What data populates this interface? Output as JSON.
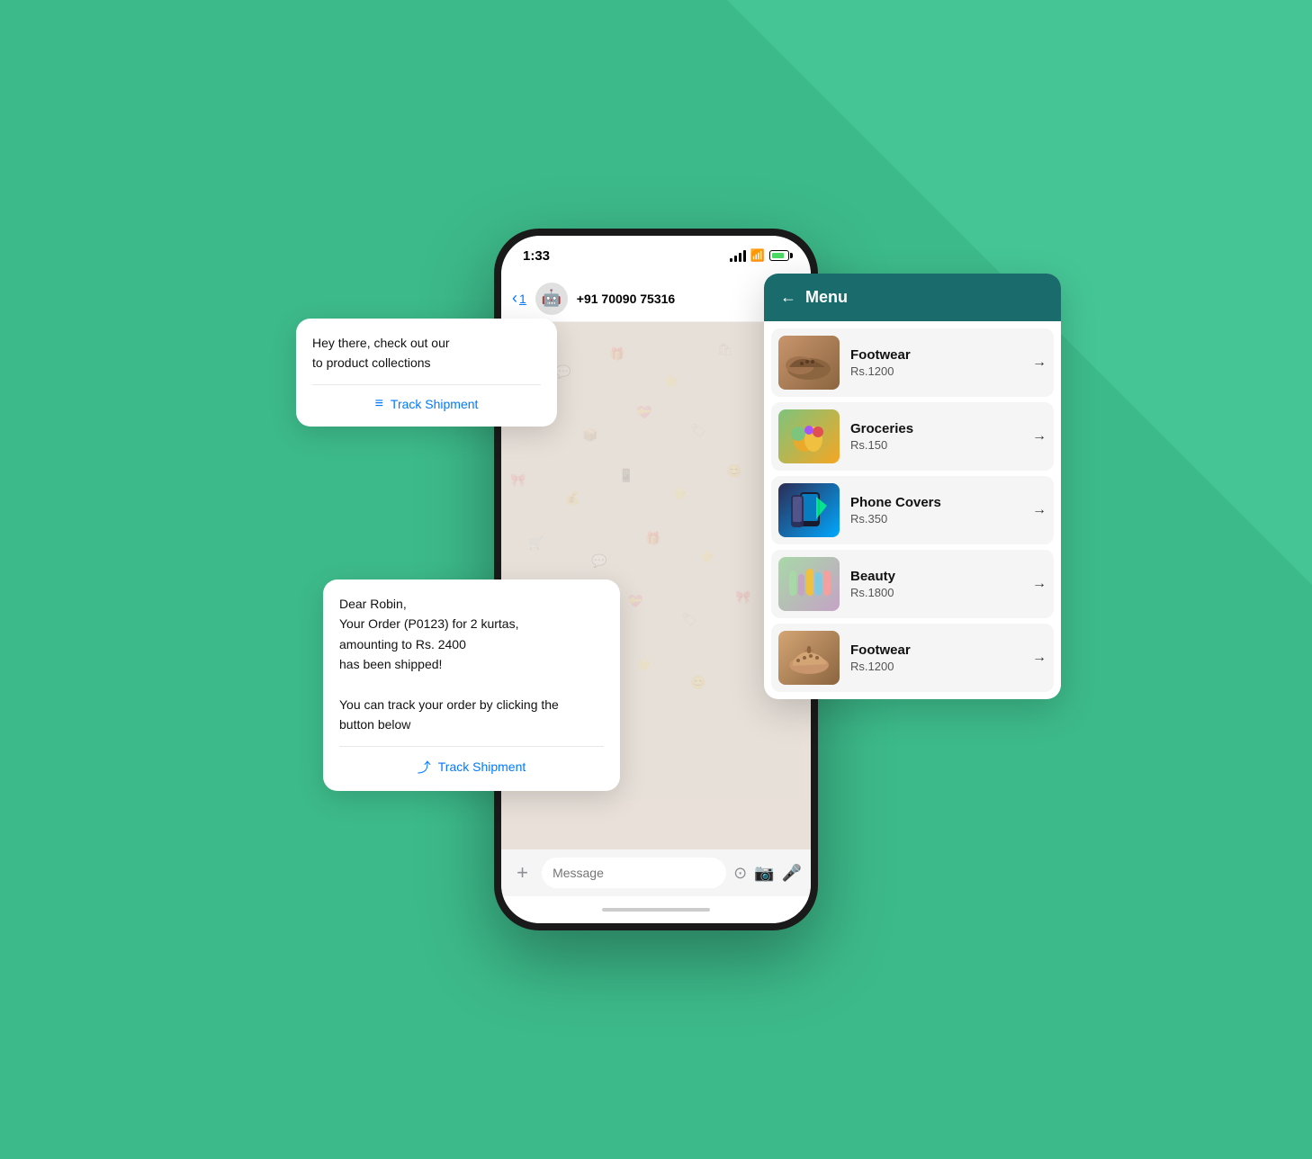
{
  "background": {
    "color": "#3dba8a"
  },
  "phone": {
    "status_bar": {
      "time": "1:33",
      "signal": "signal",
      "wifi": "wifi",
      "battery": "battery"
    },
    "chat_header": {
      "back_label": "1",
      "avatar": "🤖",
      "phone_number": "+91 70090 75316"
    },
    "input_bar": {
      "placeholder": "Message"
    },
    "home_indicator": true
  },
  "message_card_1": {
    "text": "Hey there, check out our\nto product collections",
    "button_label": "Track Shipment"
  },
  "message_card_2": {
    "text_lines": [
      "Dear Robin,",
      "Your Order (P0123) for 2 kurtas,",
      "amounting to Rs. 2400",
      "has been shipped!",
      "",
      "You can track your order by clicking the",
      "button below"
    ],
    "button_label": "Track Shipment"
  },
  "menu_card": {
    "header": {
      "back_label": "←",
      "title": "Menu"
    },
    "items": [
      {
        "name": "Footwear",
        "price": "Rs.1200",
        "emoji": "👟"
      },
      {
        "name": "Groceries",
        "price": "Rs.150",
        "emoji": "🥦"
      },
      {
        "name": "Phone Covers",
        "price": "Rs.350",
        "emoji": "📱"
      },
      {
        "name": "Beauty",
        "price": "Rs.1800",
        "emoji": "💄"
      },
      {
        "name": "Footwear",
        "price": "Rs.1200",
        "emoji": "👠"
      }
    ]
  }
}
